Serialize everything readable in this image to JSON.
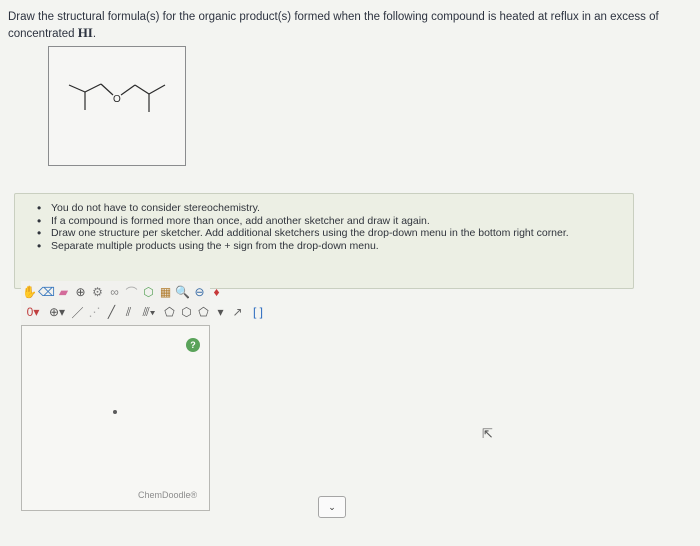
{
  "question": {
    "text": "Draw the structural formula(s) for the organic product(s) formed when the following compound is heated at reflux in an excess of concentrated ",
    "reagent": "HI",
    "end": "."
  },
  "structure": {
    "atom_label": "O"
  },
  "hints": [
    "You do not have to consider stereochemistry.",
    "If a compound is formed more than once, add another sketcher and draw it again.",
    "Draw one structure per sketcher. Add additional sketchers using the drop-down menu in the bottom right corner.",
    "Separate multiple products using the + sign from the drop-down menu."
  ],
  "sketcher": {
    "charge_label": "0",
    "help_label": "?",
    "watermark": "ChemDoodle®",
    "toolbar_row1": [
      "hand-icon",
      "erase-icon",
      "eraser-icon",
      "zoom-icon",
      "ring-icon",
      "lasso-icon",
      "chain-icon",
      "template-icon",
      "clean-icon",
      "search-icon",
      "zoom-out-icon",
      "color-icon"
    ],
    "toolbar_row2": [
      "charge-dropdown",
      "add-atom-icon",
      "single-bond-icon",
      "wedge-bond-icon",
      "bond-icon",
      "double-bond-icon",
      "triple-bond-icon",
      "cyclopentane-icon",
      "benzene-icon",
      "cyclohexane-icon",
      "ring-dropdown",
      "arrow-icon",
      "bracket-icon"
    ]
  },
  "dropdown": {
    "chevron": "⌄"
  }
}
